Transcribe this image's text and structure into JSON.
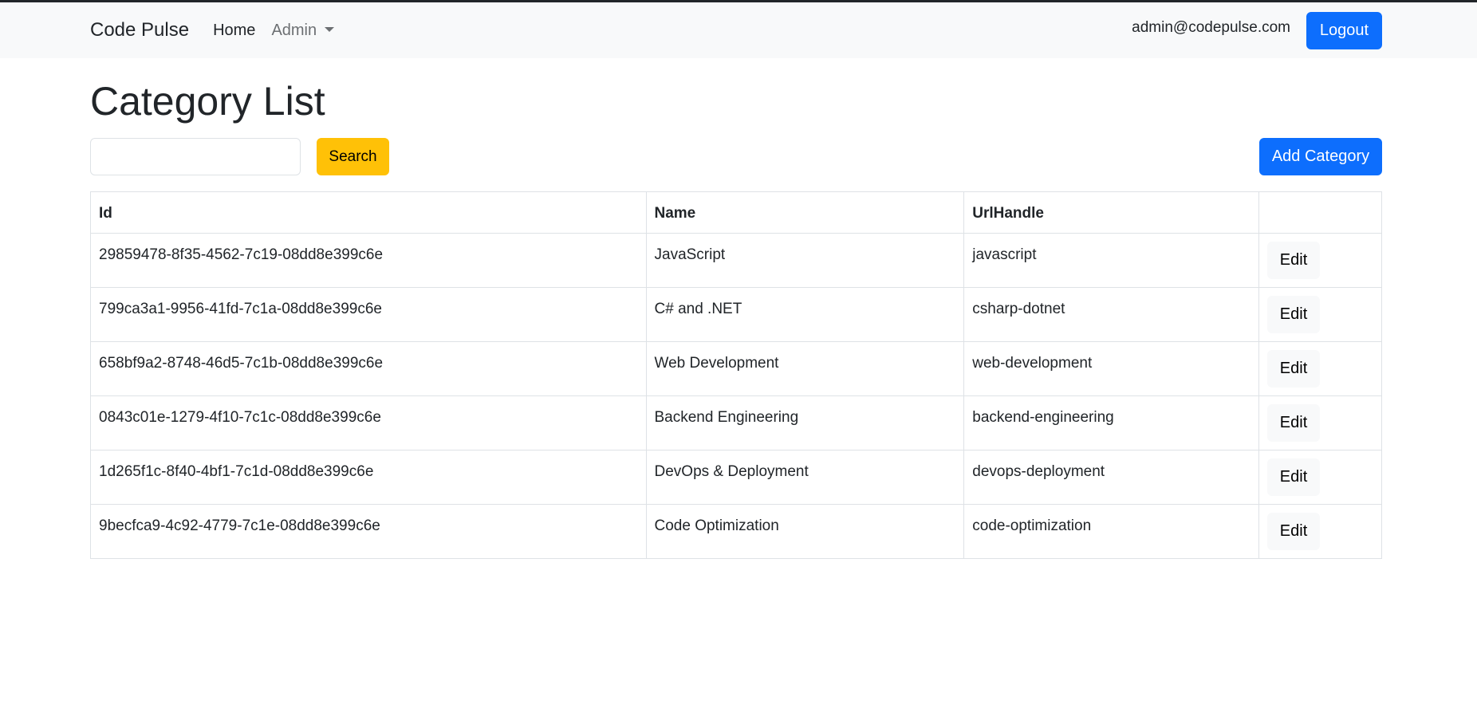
{
  "navbar": {
    "brand": "Code Pulse",
    "links": [
      {
        "label": "Home"
      },
      {
        "label": "Admin"
      }
    ],
    "user_email": "admin@codepulse.com",
    "logout_label": "Logout"
  },
  "page": {
    "title": "Category List",
    "search": {
      "value": "",
      "placeholder": ""
    },
    "search_label": "Search",
    "add_label": "Add Category"
  },
  "table": {
    "headers": [
      "Id",
      "Name",
      "UrlHandle",
      ""
    ],
    "rows": [
      {
        "id": "29859478-8f35-4562-7c19-08dd8e399c6e",
        "name": "JavaScript",
        "url_handle": "javascript",
        "action": "Edit"
      },
      {
        "id": "799ca3a1-9956-41fd-7c1a-08dd8e399c6e",
        "name": "C# and .NET",
        "url_handle": "csharp-dotnet",
        "action": "Edit"
      },
      {
        "id": "658bf9a2-8748-46d5-7c1b-08dd8e399c6e",
        "name": "Web Development",
        "url_handle": "web-development",
        "action": "Edit"
      },
      {
        "id": "0843c01e-1279-4f10-7c1c-08dd8e399c6e",
        "name": "Backend Engineering",
        "url_handle": "backend-engineering",
        "action": "Edit"
      },
      {
        "id": "1d265f1c-8f40-4bf1-7c1d-08dd8e399c6e",
        "name": "DevOps & Deployment",
        "url_handle": "devops-deployment",
        "action": "Edit"
      },
      {
        "id": "9becfca9-4c92-4779-7c1e-08dd8e399c6e",
        "name": "Code Optimization",
        "url_handle": "code-optimization",
        "action": "Edit"
      }
    ]
  },
  "colors": {
    "primary": "#0d6efd",
    "warning": "#ffc107",
    "navbar_bg": "#f8f9fa",
    "border": "#dee2e6"
  }
}
